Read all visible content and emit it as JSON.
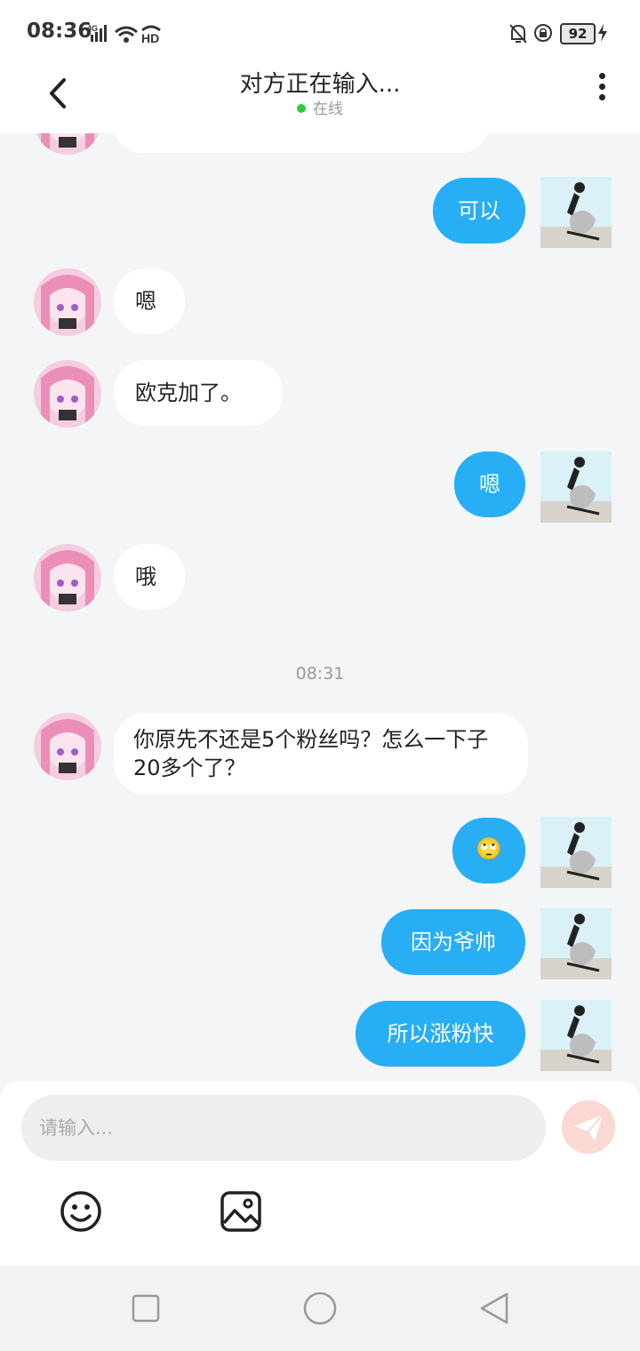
{
  "status_bar": {
    "time": "08:36",
    "network": "4G",
    "hd": "HD",
    "battery": "92",
    "icons": [
      "signal-icon",
      "wifi-icon",
      "hd-icon",
      "mute-bell-icon",
      "rotation-lock-icon",
      "battery-icon",
      "charging-icon"
    ]
  },
  "header": {
    "title": "对方正在输入...",
    "status": "在线",
    "status_color": "#2ecc40"
  },
  "messages": [
    {
      "side": "in",
      "text": ""
    },
    {
      "side": "out",
      "text": "可以"
    },
    {
      "side": "in",
      "text": "嗯"
    },
    {
      "side": "in",
      "text": "欧克加了。"
    },
    {
      "side": "out",
      "text": "嗯"
    },
    {
      "side": "in",
      "text": "哦"
    },
    {
      "side": "in",
      "text": "你原先不还是5个粉丝吗？怎么一下子20多个了？"
    },
    {
      "side": "out",
      "text": "🙄"
    },
    {
      "side": "out",
      "text": "因为爷帅"
    },
    {
      "side": "out",
      "text": "所以涨粉快"
    }
  ],
  "timestamp": "08:31",
  "input": {
    "placeholder": "请输入..."
  },
  "colors": {
    "outgoing_bubble": "#27aef4",
    "incoming_bubble": "#ffffff",
    "background": "#f3f5f7",
    "send_button": "#fbd8d2"
  }
}
